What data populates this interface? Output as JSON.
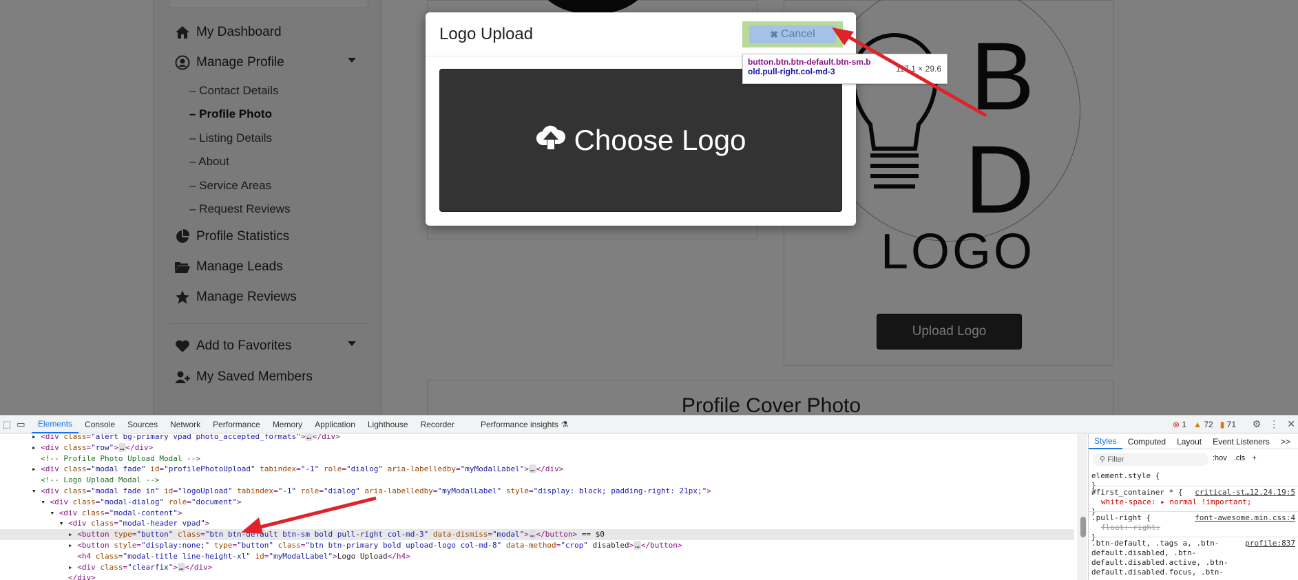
{
  "sidebar": {
    "dashboard": "My Dashboard",
    "manage_profile": "Manage Profile",
    "sub_items": [
      "– Contact Details",
      "– Profile Photo",
      "– Listing Details",
      "– About",
      "– Service Areas",
      "– Request Reviews"
    ],
    "profile_stats": "Profile Statistics",
    "manage_leads": "Manage Leads",
    "manage_reviews": "Manage Reviews",
    "add_favorites": "Add to Favorites",
    "saved_members": "My Saved Members"
  },
  "logo_card": {
    "letter_b": "B",
    "letter_d": "D",
    "word": "LOGO",
    "upload_button": "Upload Logo"
  },
  "cover": {
    "title": "Profile Cover Photo"
  },
  "modal": {
    "title": "Logo Upload",
    "cancel_label": "Cancel",
    "choose_label": "Choose Logo"
  },
  "tooltip": {
    "selector_line1": "button.btn.btn-default.btn-sm.b",
    "selector_line2": "old.pull-right.col-md-3",
    "size": "117.1 × 29.6"
  },
  "devtools": {
    "tabs": [
      "Elements",
      "Console",
      "Sources",
      "Network",
      "Performance",
      "Memory",
      "Application",
      "Lighthouse",
      "Recorder",
      "Performance insights"
    ],
    "errors": "1",
    "warnings": "72",
    "issues": "71",
    "elements_lines": [
      {
        "pre": "▸ ",
        "html": "<div class=\"alert bg-primary vpad photo_accepted_formats\">…</div>"
      },
      {
        "pre": "▸ ",
        "html": "<div class=\"row\">…</div>"
      },
      {
        "pre": "  ",
        "html": "<!-- Profile Photo Upload Modal -->"
      },
      {
        "pre": "▸ ",
        "html": "<div class=\"modal fade\" id=\"profilePhotoUpload\" tabindex=\"-1\" role=\"dialog\" aria-labelledby=\"myModalLabel\">…</div>"
      },
      {
        "pre": "  ",
        "html": "<!-- Logo Upload Modal -->"
      },
      {
        "pre": "▾ ",
        "html": "<div class=\"modal fade in\" id=\"logoUpload\" tabindex=\"-1\" role=\"dialog\" aria-labelledby=\"myModalLabel\" style=\"display: block; padding-right: 21px;\">"
      },
      {
        "pre": "  ▾ ",
        "html": "<div class=\"modal-dialog\" role=\"document\">"
      },
      {
        "pre": "    ▾ ",
        "html": "<div class=\"modal-content\">"
      },
      {
        "pre": "      ▾ ",
        "html": "<div class=\"modal-header vpad\">"
      },
      {
        "pre": "        ▸ ",
        "html": "<button type=\"button\" class=\"btn btn-default btn-sm bold pull-right col-md-3\" data-dismiss=\"modal\">…</button> == $0"
      },
      {
        "pre": "        ▸ ",
        "html": "<button style=\"display:none;\" type=\"button\" class=\"btn btn-primary bold upload-logo col-md-8\" data-method=\"crop\" disabled>…</button>"
      },
      {
        "pre": "          ",
        "html": "<h4 class=\"modal-title line-height-xl\" id=\"myModalLabel\">Logo Upload</h4>"
      },
      {
        "pre": "        ▸ ",
        "html": "<div class=\"clearfix\">…</div>"
      },
      {
        "pre": "        ",
        "html": "</div>"
      }
    ],
    "styles_tabs": [
      "Styles",
      "Computed",
      "Layout",
      "Event Listeners",
      ">>"
    ],
    "filter_placeholder": "Filter",
    "filter_tools": [
      ":hov",
      ".cls",
      "+"
    ],
    "rules": [
      {
        "selector": "element.style {",
        "props": [],
        "close": "}",
        "src": ""
      },
      {
        "selector": "#first_container * {",
        "props": [
          {
            "text": "white-space: ▸ normal !important;",
            "strike": false
          }
        ],
        "close": "}",
        "src": "critical-st…12.24.19:5"
      },
      {
        "selector": ".pull-right {",
        "props": [
          {
            "text": "float: right;",
            "strike": true
          }
        ],
        "close": "}",
        "src": "font-awesome.min.css:4"
      },
      {
        "selector": ".btn-default, .tags a, .btn-default.disabled, .btn-default.disabled.active, .btn-default.disabled.focus, .btn-",
        "props": [],
        "close": "",
        "src": "profile:837"
      }
    ]
  },
  "colors": {
    "modal_dark_box": "#333333",
    "cancel_highlight": "#b9d99a",
    "cancel_button": "#a3c2e6",
    "arrow": "#e0232a",
    "devtools_accent": "#1a73e8"
  }
}
